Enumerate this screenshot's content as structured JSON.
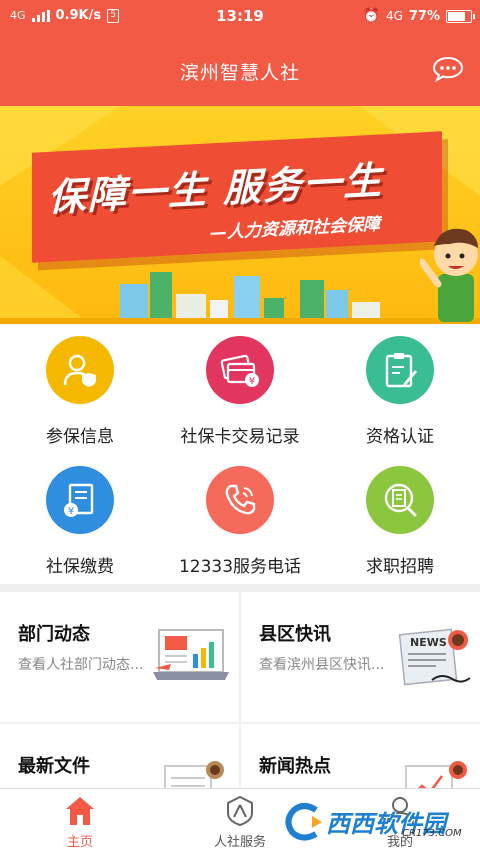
{
  "status_bar": {
    "network": "4G",
    "speed": "0.9K/s",
    "time": "13:19",
    "right_network": "4G",
    "battery": "77%"
  },
  "header": {
    "title": "滨州智慧人社",
    "message_icon": "chat-bubble-icon"
  },
  "banner": {
    "headline": "保障一生  服务一生",
    "subline": "—人力资源和社会保障"
  },
  "services": [
    {
      "label": "参保信息",
      "icon": "person-shield-icon",
      "color": "#f5b800"
    },
    {
      "label": "社保卡交易记录",
      "icon": "card-yen-icon",
      "color": "#e2355f"
    },
    {
      "label": "资格认证",
      "icon": "clipboard-pen-icon",
      "color": "#3bbd93"
    },
    {
      "label": "社保缴费",
      "icon": "receipt-yen-icon",
      "color": "#2f8ee0"
    },
    {
      "label": "12333服务电话",
      "icon": "phone-icon",
      "color": "#f46a5b"
    },
    {
      "label": "求职招聘",
      "icon": "document-search-icon",
      "color": "#8cc63f"
    }
  ],
  "cards": [
    {
      "title": "部门动态",
      "desc": "查看人社部门动态..."
    },
    {
      "title": "县区快讯",
      "desc": "查看滨州县区快讯..."
    },
    {
      "title": "最新文件",
      "desc": ""
    },
    {
      "title": "新闻热点",
      "desc": ""
    }
  ],
  "bottom_nav": {
    "home": "主页",
    "service": "人社服务",
    "mine": "我的"
  },
  "watermark": {
    "text": "西西软件园",
    "sub": "CR173.COM"
  },
  "colors": {
    "accent": "#f25a45",
    "banner_yellow": "#ffc21a"
  }
}
